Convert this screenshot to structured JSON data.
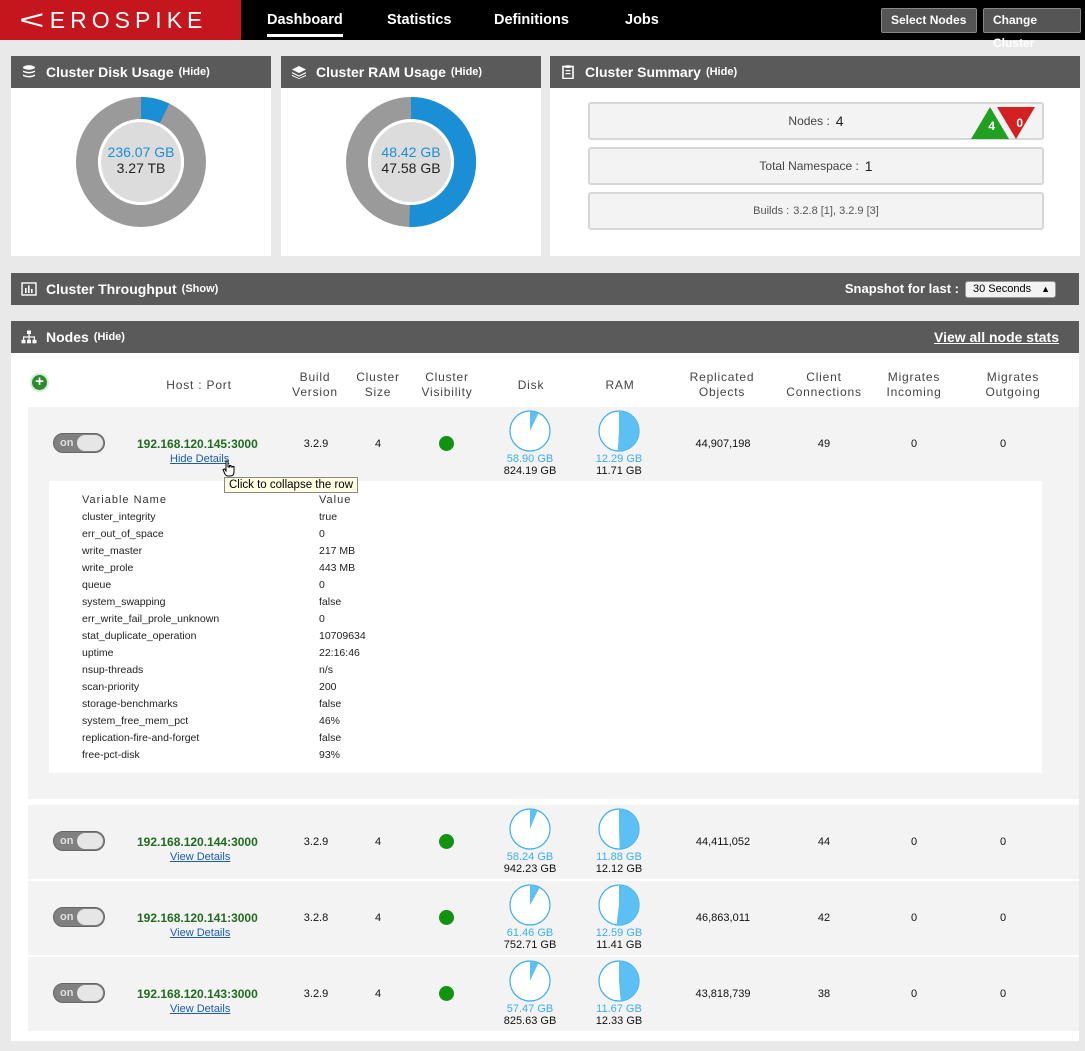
{
  "brand": {
    "mark": "<",
    "word": "EROSPIKE"
  },
  "nav": {
    "dashboard": "Dashboard",
    "statistics": "Statistics",
    "definitions": "Definitions",
    "jobs": "Jobs"
  },
  "topbar": {
    "select_nodes": "Select Nodes",
    "change_cluster": "Change Cluster"
  },
  "colors": {
    "brand_red": "#c4161c",
    "accent_blue": "#1a8fd6",
    "node_green": "#119311",
    "pie_blue": "#39aef0"
  },
  "disk_panel": {
    "title": "Cluster Disk Usage",
    "hide": "(Hide)",
    "used": "236.07 GB",
    "total": "3.27 TB",
    "used_fraction": 0.072
  },
  "ram_panel": {
    "title": "Cluster RAM Usage",
    "hide": "(Hide)",
    "used": "48.42 GB",
    "total": "47.58 GB",
    "used_fraction": 0.504
  },
  "summary_panel": {
    "title": "Cluster Summary",
    "hide": "(Hide)",
    "nodes_label": "Nodes :",
    "nodes_value": "4",
    "nodes_up": "4",
    "nodes_down": "0",
    "namespace_label": "Total Namespace :",
    "namespace_value": "1",
    "builds_label": "Builds :",
    "builds_value": "3.2.8 [1], 3.2.9 [3]"
  },
  "throughput_panel": {
    "title": "Cluster Throughput",
    "show": "(Show)",
    "snapshot_label": "Snapshot for last :",
    "snapshot_value": "30 Seconds"
  },
  "nodes_panel": {
    "title": "Nodes",
    "hide": "(Hide)",
    "view_all": "View all node stats",
    "columns": {
      "host": "Host : Port",
      "build_1": "Build",
      "build_2": "Version",
      "size_1": "Cluster",
      "size_2": "Size",
      "vis_1": "Cluster",
      "vis_2": "Visibility",
      "disk": "Disk",
      "ram": "RAM",
      "repl_1": "Replicated",
      "repl_2": "Objects",
      "conn_1": "Client",
      "conn_2": "Connections",
      "migin_1": "Migrates",
      "migin_2": "Incoming",
      "migout_1": "Migrates",
      "migout_2": "Outgoing"
    },
    "rows": [
      {
        "toggle": "on",
        "host": "192.168.120.145:3000",
        "details": "Hide Details",
        "build": "3.2.9",
        "size": "4",
        "disk_used": "58.90 GB",
        "disk_total": "824.19 GB",
        "disk_frac": 0.071,
        "ram_used": "12.29 GB",
        "ram_total": "11.71 GB",
        "ram_frac": 0.51,
        "objects": "44,907,198",
        "connections": "49",
        "mig_in": "0",
        "mig_out": "0"
      },
      {
        "toggle": "on",
        "host": "192.168.120.144:3000",
        "details": "View Details",
        "build": "3.2.9",
        "size": "4",
        "disk_used": "58.24 GB",
        "disk_total": "942.23 GB",
        "disk_frac": 0.062,
        "ram_used": "11.88 GB",
        "ram_total": "12.12 GB",
        "ram_frac": 0.495,
        "objects": "44,411,052",
        "connections": "44",
        "mig_in": "0",
        "mig_out": "0"
      },
      {
        "toggle": "on",
        "host": "192.168.120.141:3000",
        "details": "View Details",
        "build": "3.2.8",
        "size": "4",
        "disk_used": "61.46 GB",
        "disk_total": "752.71 GB",
        "disk_frac": 0.082,
        "ram_used": "12.59 GB",
        "ram_total": "11.41 GB",
        "ram_frac": 0.52,
        "objects": "46,863,011",
        "connections": "42",
        "mig_in": "0",
        "mig_out": "0"
      },
      {
        "toggle": "on",
        "host": "192.168.120.143:3000",
        "details": "View Details",
        "build": "3.2.9",
        "size": "4",
        "disk_used": "57.47 GB",
        "disk_total": "825.63 GB",
        "disk_frac": 0.07,
        "ram_used": "11.67 GB",
        "ram_total": "12.33 GB",
        "ram_frac": 0.486,
        "objects": "43,818,739",
        "connections": "38",
        "mig_in": "0",
        "mig_out": "0"
      }
    ],
    "details": {
      "header_name": "Variable Name",
      "header_value": "Value",
      "vars": [
        {
          "name": "cluster_integrity",
          "value": "true"
        },
        {
          "name": "err_out_of_space",
          "value": "0"
        },
        {
          "name": "write_master",
          "value": "217 MB"
        },
        {
          "name": "write_prole",
          "value": "443 MB"
        },
        {
          "name": "queue",
          "value": "0"
        },
        {
          "name": "system_swapping",
          "value": "false"
        },
        {
          "name": "err_write_fail_prole_unknown",
          "value": "0"
        },
        {
          "name": "stat_duplicate_operation",
          "value": "10709634"
        },
        {
          "name": "uptime",
          "value": "22:16:46"
        },
        {
          "name": "nsup-threads",
          "value": "n/s"
        },
        {
          "name": "scan-priority",
          "value": "200"
        },
        {
          "name": "storage-benchmarks",
          "value": "false"
        },
        {
          "name": "system_free_mem_pct",
          "value": "46%"
        },
        {
          "name": "replication-fire-and-forget",
          "value": "false"
        },
        {
          "name": "free-pct-disk",
          "value": "93%"
        }
      ]
    }
  },
  "tooltip": "Click to collapse the row"
}
